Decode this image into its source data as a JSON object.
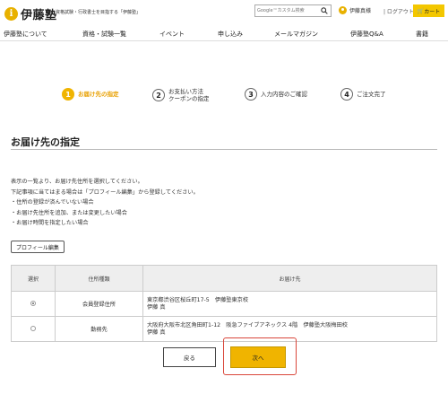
{
  "header": {
    "logo_mark": "i",
    "logo_text": "伊藤塾",
    "tagline": "資格試験・行政書士を目指する「伊藤塾」",
    "search_placeholder": "Google™カスタム検索",
    "user_name": "伊藤真様",
    "logout": "| ログアウト",
    "cart": "カート"
  },
  "nav": {
    "items": [
      "伊藤塾について",
      "資格・試験一覧",
      "イベント",
      "申し込み",
      "メールマガジン",
      "伊藤塾Q&A",
      "書籍"
    ]
  },
  "steps": [
    {
      "num": "1",
      "line1": "お届け先の指定",
      "line2": ""
    },
    {
      "num": "2",
      "line1": "お支払い方法",
      "line2": "クーポンの指定"
    },
    {
      "num": "3",
      "line1": "入力内容のご確認",
      "line2": ""
    },
    {
      "num": "4",
      "line1": "ご注文完了",
      "line2": ""
    }
  ],
  "main": {
    "title": "お届け先の指定",
    "description": [
      "表示の一覧より、お届け先住所を選択してください。",
      "下記事項に当てはまる場合は「プロフィール編集」から登録してください。",
      "・住所の登録が済んでいない場合",
      "・お届け先住所を追加、または変更したい場合",
      "・お届け時間を指定したい場合"
    ],
    "profile_button": "プロフィール編集"
  },
  "table": {
    "headers": [
      "選択",
      "住所種類",
      "お届け先"
    ],
    "rows": [
      {
        "selected": true,
        "type": "会員登録住所",
        "line1": "東京都渋谷区桜丘町17-5　伊藤塾東京校",
        "line2": "伊藤 真",
        "line3": ""
      },
      {
        "selected": false,
        "type": "勤務先",
        "line1": "大阪府大阪市北区角田町1-12　阪急ファイブアネックス 4階　伊藤塾大阪梅田校",
        "line2": "伊藤 真",
        "line3": ""
      }
    ]
  },
  "buttons": {
    "back": "戻る",
    "next": "次へ"
  }
}
